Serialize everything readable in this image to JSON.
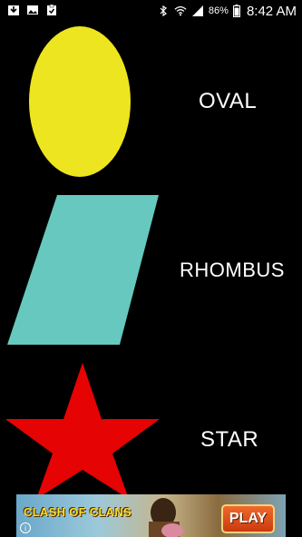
{
  "status_bar": {
    "battery_percent": "86%",
    "time": "8:42 AM",
    "icons": [
      "download-icon",
      "image-icon",
      "clipboard-check-icon",
      "bluetooth-icon",
      "wifi-icon",
      "signal-icon",
      "battery-icon"
    ]
  },
  "shapes": [
    {
      "name": "oval",
      "label": "OVAL",
      "color": "#EDE51F"
    },
    {
      "name": "rhombus",
      "label": "RHOMBUS",
      "color": "#66C8BE"
    },
    {
      "name": "star",
      "label": "STAR",
      "color": "#E50303"
    }
  ],
  "ad": {
    "brand": "CLASH OF CLANS",
    "cta": "PLAY",
    "info": "i"
  }
}
